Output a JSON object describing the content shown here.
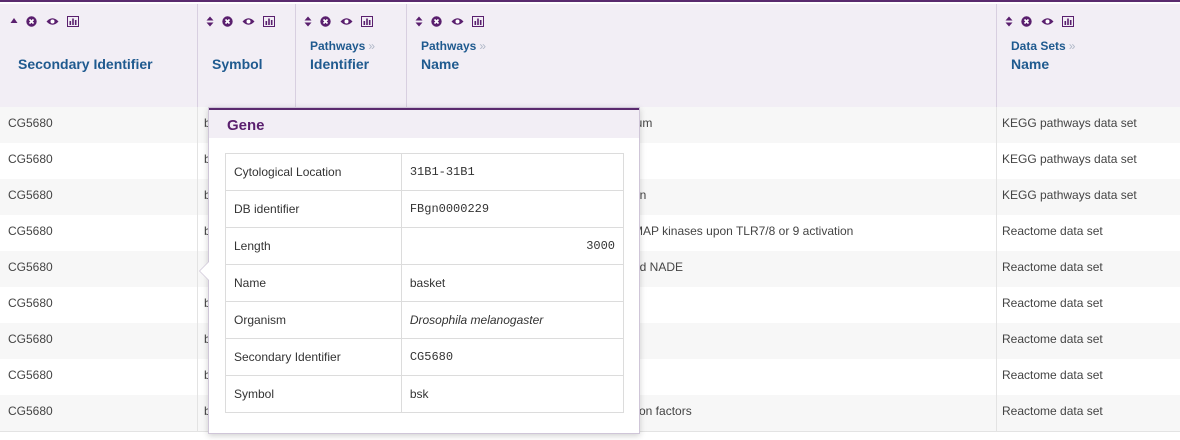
{
  "columns": [
    {
      "path": "",
      "title": "Secondary Identifier",
      "sort": "up"
    },
    {
      "path": "",
      "title": "Symbol",
      "sort": "both"
    },
    {
      "path": "Pathways",
      "title": "Identifier",
      "sort": "both"
    },
    {
      "path": "Pathways",
      "title": "Name",
      "sort": "both"
    },
    {
      "path": "Data Sets",
      "title": "Name",
      "sort": "both"
    }
  ],
  "rows": [
    {
      "secondary": "CG5680",
      "symbol": "b",
      "pathway_name": "lum",
      "dataset": "KEGG pathways data set"
    },
    {
      "secondary": "CG5680",
      "symbol": "b",
      "pathway_name": "",
      "dataset": "KEGG pathways data set"
    },
    {
      "secondary": "CG5680",
      "symbol": "b",
      "pathway_name": "on",
      "dataset": "KEGG pathways data set"
    },
    {
      "secondary": "CG5680",
      "symbol": "b",
      "pathway_name": "MAP kinases upon TLR7/8 or 9 activation",
      "dataset": "Reactome data set"
    },
    {
      "secondary": "CG5680",
      "symbol": "",
      "pathway_name": "nd NADE",
      "dataset": "Reactome data set"
    },
    {
      "secondary": "CG5680",
      "symbol": "b",
      "pathway_name": "",
      "dataset": "Reactome data set"
    },
    {
      "secondary": "CG5680",
      "symbol": "b",
      "pathway_name": "",
      "dataset": "Reactome data set"
    },
    {
      "secondary": "CG5680",
      "symbol": "b",
      "pathway_name": "",
      "dataset": "Reactome data set"
    },
    {
      "secondary": "CG5680",
      "symbol": "b",
      "pathway_name": "tion factors",
      "dataset": "Reactome data set"
    }
  ],
  "popup": {
    "title": "Gene",
    "fields": [
      {
        "key": "Cytological Location",
        "value": "31B1-31B1"
      },
      {
        "key": "DB identifier",
        "value": "FBgn0000229"
      },
      {
        "key": "Length",
        "value": "3000"
      },
      {
        "key": "Name",
        "value": "basket"
      },
      {
        "key": "Organism",
        "value": "Drosophila melanogaster"
      },
      {
        "key": "Secondary Identifier",
        "value": "CG5680"
      },
      {
        "key": "Symbol",
        "value": "bsk"
      }
    ]
  },
  "colors": {
    "accent": "#5a2a6e",
    "header_text": "#1f5a8f",
    "header_bg": "#f2eef5"
  },
  "icons": [
    "sort-icon",
    "remove-column-icon",
    "eye-icon",
    "summary-chart-icon"
  ]
}
